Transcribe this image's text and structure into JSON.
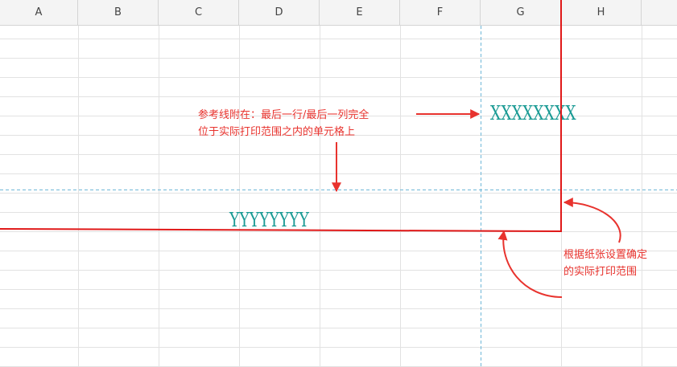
{
  "spreadsheet": {
    "columns": [
      "A",
      "B",
      "C",
      "D",
      "E",
      "F",
      "G",
      "H"
    ],
    "cells": {
      "g6": "XXXXXXXX",
      "d11": "YYYYYYYY"
    }
  },
  "annotations": {
    "snap_line1": "参考线附在：最后一行/最后一列完全",
    "snap_line2": "位于实际打印范围之内的单元格上",
    "print_line1": "根据纸张设置确定",
    "print_line2": "的实际打印范围"
  },
  "colors": {
    "annotation": "#e8332e",
    "cell_text": "#1a9a94",
    "guide_line": "#6fb7d8",
    "print_boundary": "#e01818",
    "grid": "#e2e2e2",
    "header_bg": "#f4f4f4"
  }
}
